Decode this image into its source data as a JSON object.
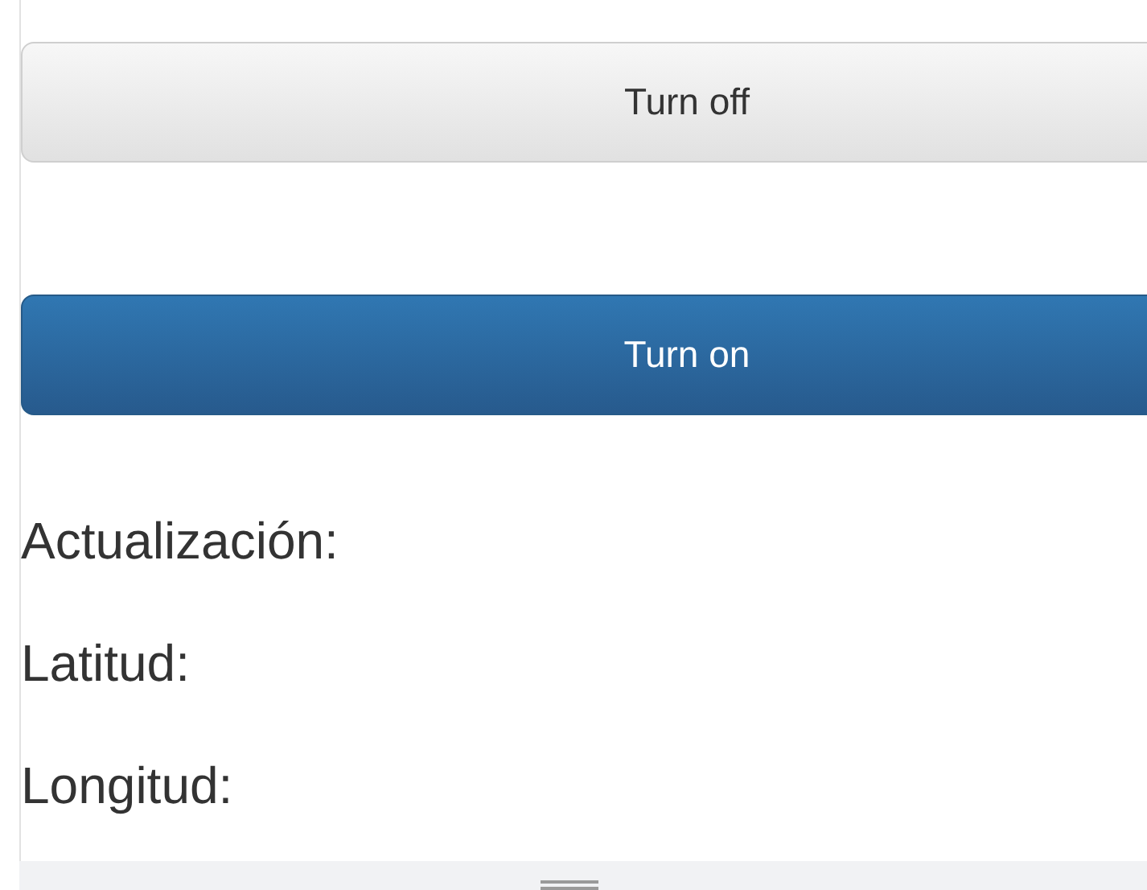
{
  "buttons": [
    {
      "label": "Turn off",
      "kind": "default"
    },
    {
      "label": "Turn on",
      "kind": "primary"
    }
  ],
  "fields": [
    {
      "label": "Actualización:"
    },
    {
      "label": "Latitud:"
    },
    {
      "label": "Longitud:"
    }
  ],
  "bottom_bar": {
    "kind": "handle"
  }
}
